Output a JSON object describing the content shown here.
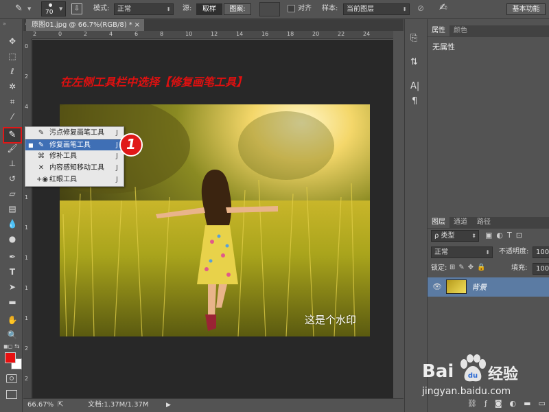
{
  "options_bar": {
    "brush_size": "70",
    "mode_label": "模式:",
    "mode_value": "正常",
    "source_label": "源:",
    "sample_btn": "取样",
    "pattern_btn": "图案:",
    "align_label": "对齐",
    "sample_label": "样本:",
    "sample_value": "当前图层",
    "workspace_btn": "基本功能"
  },
  "document": {
    "tab_title": "原图01.jpg @ 66.7%(RGB/8) *",
    "tab_close": "×",
    "zoom": "66.67%",
    "doc_info": "文档:1.37M/1.37M"
  },
  "ruler_top": [
    "2",
    "0",
    "2",
    "4",
    "6",
    "8",
    "10",
    "12",
    "14",
    "16",
    "18",
    "20",
    "22",
    "24"
  ],
  "ruler_left": [
    "0",
    "2",
    "4",
    "6",
    "8",
    "1",
    "1",
    "1",
    "1",
    "1",
    "2",
    "2"
  ],
  "annotation": {
    "instruction": "在左侧工具栏中选择【修复画笔工具】",
    "badge": "1"
  },
  "context_menu": {
    "items": [
      {
        "label": "污点修复画笔工具",
        "shortcut": "J",
        "icon": "spot-healing-icon",
        "selected": false
      },
      {
        "label": "修复画笔工具",
        "shortcut": "J",
        "icon": "healing-brush-icon",
        "selected": true
      },
      {
        "label": "修补工具",
        "shortcut": "J",
        "icon": "patch-icon",
        "selected": false
      },
      {
        "label": "内容感知移动工具",
        "shortcut": "J",
        "icon": "content-aware-move-icon",
        "selected": false
      },
      {
        "label": "红眼工具",
        "shortcut": "J",
        "icon": "red-eye-icon",
        "selected": false
      }
    ]
  },
  "watermark": "这是个水印",
  "properties_panel": {
    "tab_properties": "属性",
    "tab_color": "颜色",
    "content": "无属性"
  },
  "layers_panel": {
    "tab_layers": "图层",
    "tab_channels": "通道",
    "tab_paths": "路径",
    "filter_label": "ρ 类型",
    "blend_mode": "正常",
    "opacity_label": "不透明度:",
    "opacity_value": "100",
    "lock_label": "锁定:",
    "fill_label": "填充:",
    "fill_value": "100",
    "layer_name": "背景"
  },
  "footer_logo": {
    "brand": "Bai",
    "brand2": "du",
    "site": "经验",
    "url": "jingyan.baidu.com"
  },
  "colors": {
    "accent_red": "#e01010",
    "foreground": "#e81010",
    "background": "#ffffff",
    "selected_layer": "#5b7ba3"
  }
}
